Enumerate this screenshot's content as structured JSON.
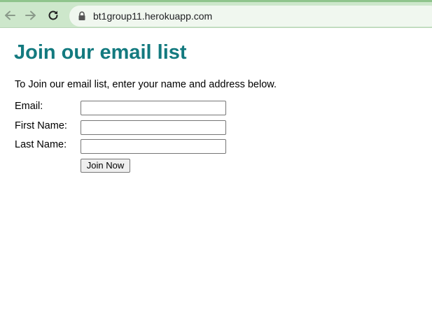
{
  "browser": {
    "url": "bt1group11.herokuapp.com",
    "icons": {
      "back": "back-arrow-icon",
      "forward": "forward-arrow-icon",
      "reload": "reload-icon",
      "lock": "lock-icon"
    },
    "colors": {
      "toolbar": "#cde7cb",
      "accent": "#8fc48c",
      "omnibox": "#f0f7ef"
    }
  },
  "page": {
    "title": "Join our email list",
    "title_color": "#137a7f",
    "intro": "To Join our email list, enter your name and address below.",
    "form": {
      "email_label": "Email:",
      "email_value": "",
      "first_name_label": "First Name:",
      "first_name_value": "",
      "last_name_label": "Last Name:",
      "last_name_value": "",
      "submit_label": "Join Now"
    }
  }
}
